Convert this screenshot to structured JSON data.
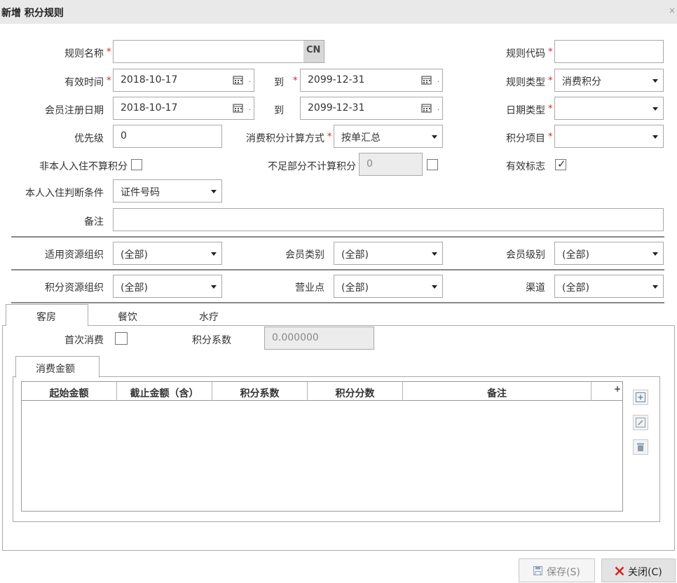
{
  "window": {
    "title": "新增 积分规则",
    "close_glyph": "×"
  },
  "form": {
    "rule_name": {
      "label": "规则名称",
      "value": "",
      "lang_badge": "CN"
    },
    "rule_code": {
      "label": "规则代码",
      "value": ""
    },
    "valid_time": {
      "label": "有效时间",
      "from": "2018-10-17",
      "to_label": "到",
      "to": "2099-12-31"
    },
    "rule_type": {
      "label": "规则类型",
      "value": "消费积分"
    },
    "member_reg_date": {
      "label": "会员注册日期",
      "from": "2018-10-17",
      "to_label": "到",
      "to": "2099-12-31"
    },
    "date_type": {
      "label": "日期类型",
      "value": ""
    },
    "priority": {
      "label": "优先级",
      "value": "0"
    },
    "calc_method": {
      "label": "消费积分计算方式",
      "value": "按单汇总"
    },
    "points_item": {
      "label": "积分项目",
      "value": ""
    },
    "non_self_checkin": {
      "label": "非本人入住不算积分",
      "checked": false
    },
    "insufficient_part": {
      "label": "不足部分不计算积分",
      "value": "0",
      "checked": false
    },
    "valid_flag": {
      "label": "有效标志",
      "checked": true
    },
    "self_checkin_condition": {
      "label": "本人入住判断条件",
      "value": "证件号码"
    },
    "remark": {
      "label": "备注",
      "value": ""
    },
    "applicable_org": {
      "label": "适用资源组织",
      "value": "(全部)"
    },
    "member_category": {
      "label": "会员类别",
      "value": "(全部)"
    },
    "member_level": {
      "label": "会员级别",
      "value": "(全部)"
    },
    "points_org": {
      "label": "积分资源组织",
      "value": "(全部)"
    },
    "business_point": {
      "label": "营业点",
      "value": "(全部)"
    },
    "channel": {
      "label": "渠道",
      "value": "(全部)"
    }
  },
  "tabs": [
    {
      "label": "客房"
    },
    {
      "label": "餐饮"
    },
    {
      "label": "水疗"
    }
  ],
  "room_tab": {
    "first_consumption": {
      "label": "首次消费",
      "checked": false
    },
    "points_coef": {
      "label": "积分系数",
      "value": "0.000000"
    },
    "subtab": "消费金额",
    "table": {
      "columns": [
        "起始金额",
        "截止金额（含）",
        "积分系数",
        "积分分数",
        "备注"
      ],
      "add_col_glyph": "+",
      "rows": []
    }
  },
  "footer": {
    "save_label": "保存(S)",
    "save_icon": "floppy-icon",
    "close_label": "关闭(C)",
    "close_icon": "close-x-icon",
    "close_color": "#d81e1e"
  }
}
